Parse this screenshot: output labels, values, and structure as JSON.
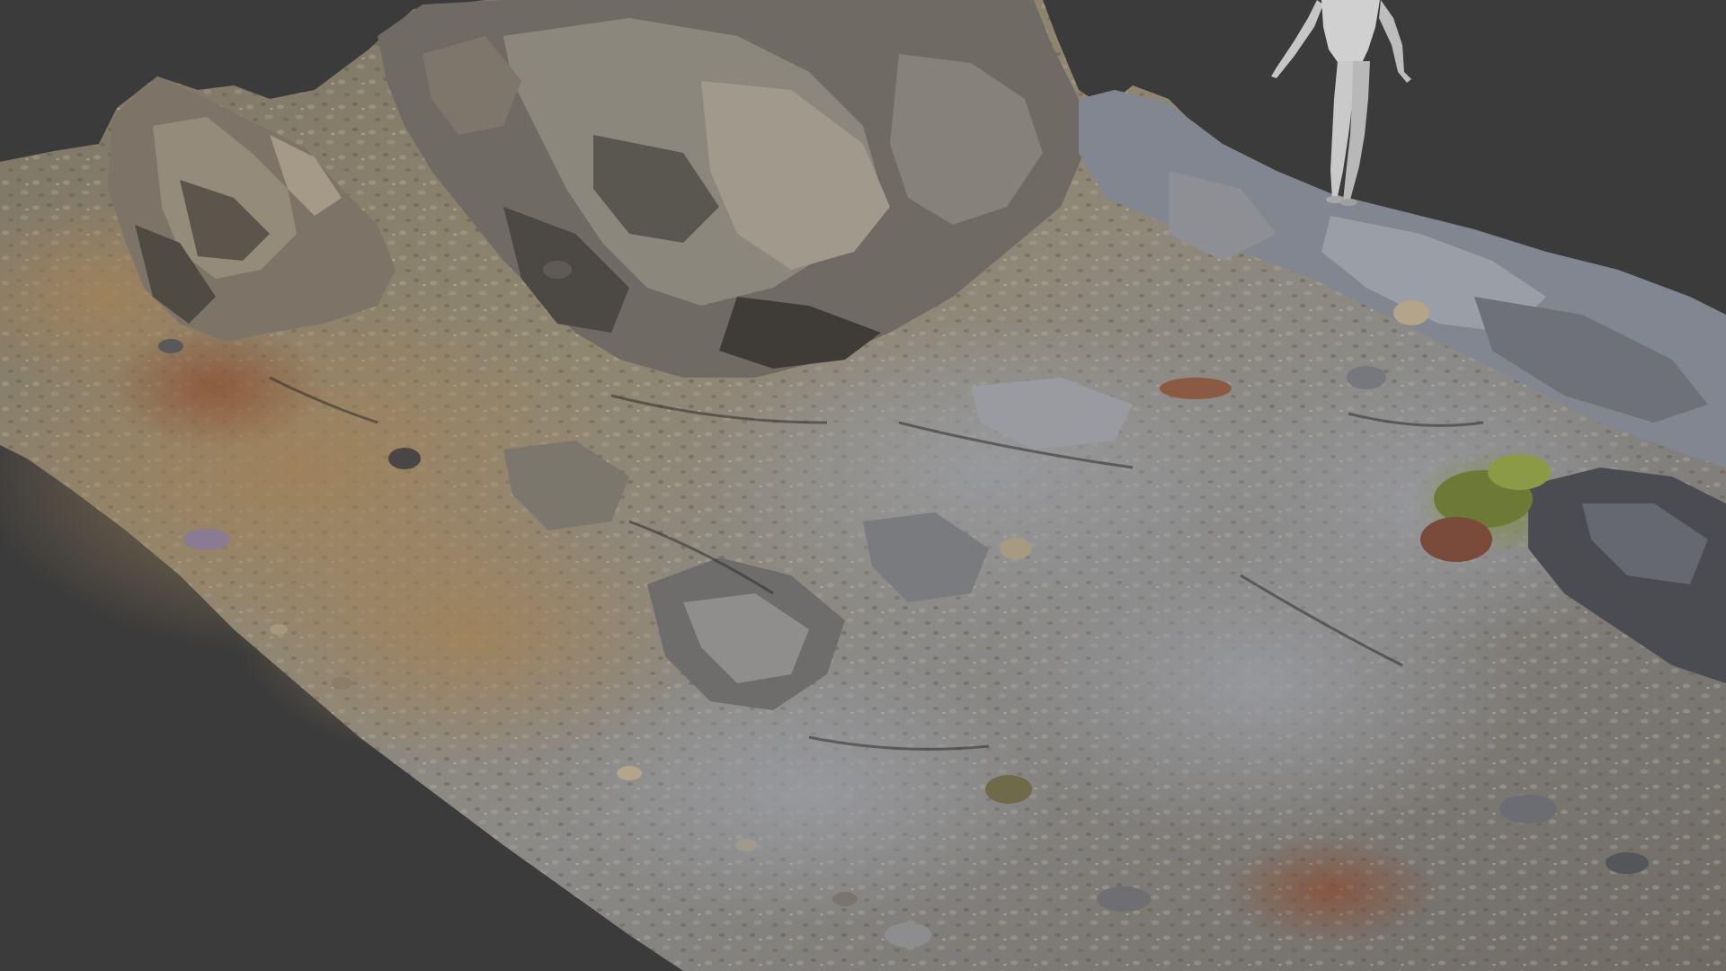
{
  "scene": {
    "background_color": "#3b3b3b",
    "subject": "photogrammetry-rock-terrain-scan",
    "reference_figure": "mannequin-scale-reference",
    "palette": {
      "rock_gray": "#8a8b8c",
      "rock_dark": "#4a4845",
      "soil_tan": "#9a8566",
      "soil_brown": "#7a5e44",
      "rust": "#8a4a2e",
      "moss_green": "#6e7a3a",
      "mannequin": "#c8c8c8"
    }
  }
}
